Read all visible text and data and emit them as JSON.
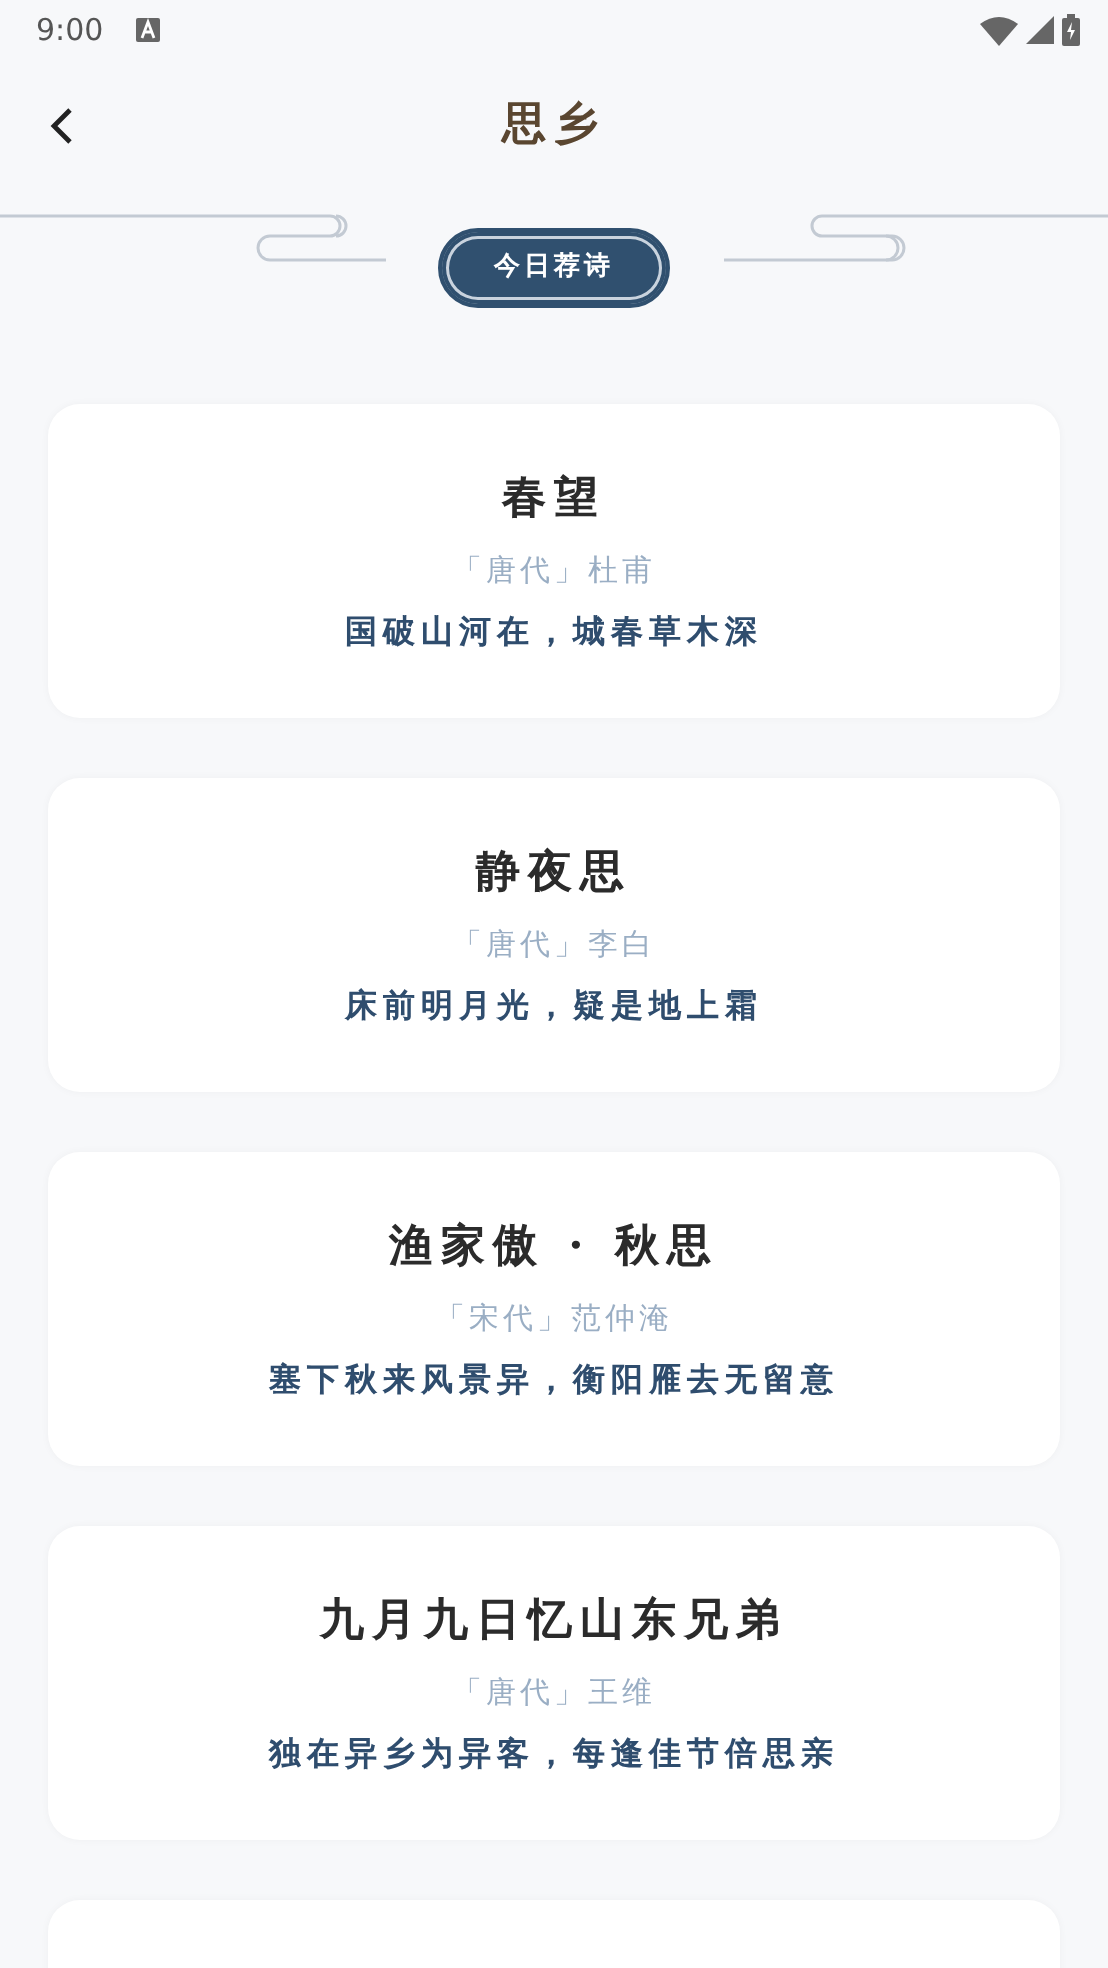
{
  "status_bar": {
    "time": "9:00"
  },
  "header": {
    "title": "思乡"
  },
  "recommend_button": {
    "label": "今日荐诗"
  },
  "poems": [
    {
      "title": "春望",
      "dynasty": "「唐代」",
      "author": "杜甫",
      "line": "国破山河在，城春草木深"
    },
    {
      "title": "静夜思",
      "dynasty": "「唐代」",
      "author": "李白",
      "line": "床前明月光，疑是地上霜"
    },
    {
      "title": "渔家傲 · 秋思",
      "dynasty": "「宋代」",
      "author": "范仲淹",
      "line": "塞下秋来风景异，衡阳雁去无留意"
    },
    {
      "title": "九月九日忆山东兄弟",
      "dynasty": "「唐代」",
      "author": "王维",
      "line": "独在异乡为异客，每逢佳节倍思亲"
    }
  ]
}
